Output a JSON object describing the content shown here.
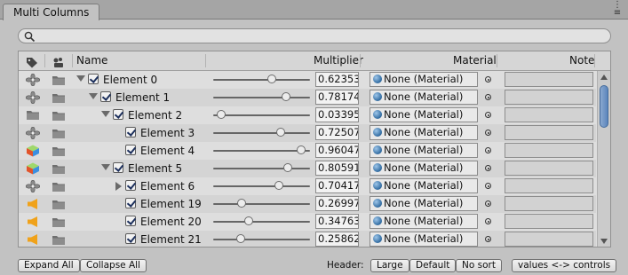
{
  "window": {
    "tab_title": "Multi Columns",
    "menu_icon": "window-menu-icon"
  },
  "search": {
    "value": "",
    "placeholder": "",
    "icon": "search-icon"
  },
  "columns": {
    "icon1": "tag-icon",
    "icon2": "scene-icon",
    "name": "Name",
    "multiplier": "Multiplier",
    "material": "Material",
    "note": "Note"
  },
  "rows": [
    {
      "icon": "propeller-icon",
      "indent": 0,
      "arrow": "expanded",
      "checked": true,
      "name": "Element 0",
      "slider": 0.62353,
      "multiplier": "0.62353",
      "material": "None (Material)",
      "note": ""
    },
    {
      "icon": "propeller-icon",
      "indent": 1,
      "arrow": "expanded",
      "checked": true,
      "name": "Element 1",
      "slider": 0.78174,
      "multiplier": "0.78174",
      "material": "None (Material)",
      "note": ""
    },
    {
      "icon": "folder-icon",
      "indent": 2,
      "arrow": "expanded",
      "checked": true,
      "name": "Element 2",
      "slider": 0.03395,
      "multiplier": "0.03395",
      "material": "None (Material)",
      "note": ""
    },
    {
      "icon": "propeller-icon",
      "indent": 3,
      "arrow": "none",
      "checked": true,
      "name": "Element 3",
      "slider": 0.72507,
      "multiplier": "0.72507",
      "material": "None (Material)",
      "note": ""
    },
    {
      "icon": "cube-icon",
      "indent": 3,
      "arrow": "none",
      "checked": true,
      "name": "Element 4",
      "slider": 0.96047,
      "multiplier": "0.96047",
      "material": "None (Material)",
      "note": ""
    },
    {
      "icon": "cube-icon",
      "indent": 2,
      "arrow": "expanded",
      "checked": true,
      "name": "Element 5",
      "slider": 0.80591,
      "multiplier": "0.80591",
      "material": "None (Material)",
      "note": ""
    },
    {
      "icon": "propeller-icon",
      "indent": 3,
      "arrow": "collapsed",
      "checked": true,
      "name": "Element 6",
      "slider": 0.70417,
      "multiplier": "0.70417",
      "material": "None (Material)",
      "note": ""
    },
    {
      "icon": "horn-icon",
      "indent": 3,
      "arrow": "none",
      "checked": true,
      "name": "Element 19",
      "slider": 0.26997,
      "multiplier": "0.26997",
      "material": "None (Material)",
      "note": ""
    },
    {
      "icon": "horn-icon",
      "indent": 3,
      "arrow": "none",
      "checked": true,
      "name": "Element 20",
      "slider": 0.34763,
      "multiplier": "0.34763",
      "material": "None (Material)",
      "note": ""
    },
    {
      "icon": "horn-icon",
      "indent": 3,
      "arrow": "none",
      "checked": true,
      "name": "Element 21",
      "slider": 0.25862,
      "multiplier": "0.25862",
      "material": "None (Material)",
      "note": ""
    }
  ],
  "toolbar": {
    "expand_all": "Expand All",
    "collapse_all": "Collapse All",
    "header_label": "Header:",
    "large": "Large",
    "default": "Default",
    "no_sort": "No sort",
    "values_controls": "values <-> controls"
  },
  "colors": {
    "accent": "#5b86bd",
    "background": "#c2c2c2",
    "horn": "#f0a21a"
  }
}
